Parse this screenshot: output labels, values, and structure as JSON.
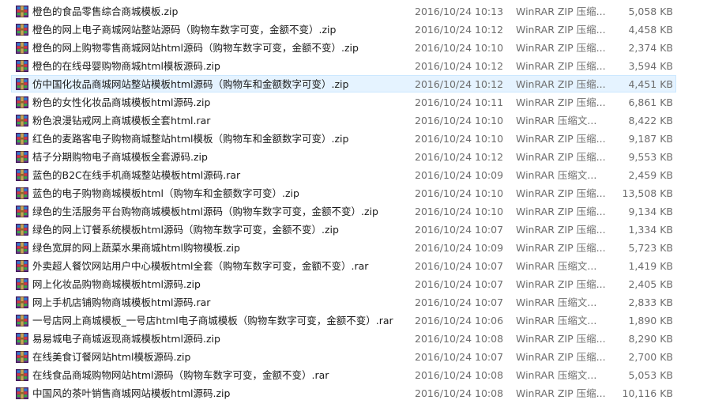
{
  "icon_name": "winrar-archive-icon",
  "colors": {
    "selected_row_bg": "#e5f3ff",
    "selected_row_border": "#cce8ff",
    "secondary_text": "#6d6d6d"
  },
  "files": [
    {
      "name": "橙色的食品零售综合商城模板.zip",
      "date": "2016/10/24 10:13",
      "type": "WinRAR ZIP 压缩...",
      "size": "5,058 KB"
    },
    {
      "name": "橙色的网上电子商城网站整站源码（购物车数字可变，金额不变）.zip",
      "date": "2016/10/24 10:12",
      "type": "WinRAR ZIP 压缩...",
      "size": "4,458 KB"
    },
    {
      "name": "橙色的网上购物零售商城网站html源码（购物车数字可变，金额不变）.zip",
      "date": "2016/10/24 10:10",
      "type": "WinRAR ZIP 压缩...",
      "size": "2,374 KB"
    },
    {
      "name": "橙色的在线母婴购物商城html模板源码.zip",
      "date": "2016/10/24 10:12",
      "type": "WinRAR ZIP 压缩...",
      "size": "3,594 KB"
    },
    {
      "name": "仿中国化妆品商城网站整站模板html源码（购物车和金额数字可变）.zip",
      "date": "2016/10/24 10:12",
      "type": "WinRAR ZIP 压缩...",
      "size": "4,451 KB",
      "selected": true
    },
    {
      "name": "粉色的女性化妆品商城模板html源码.zip",
      "date": "2016/10/24 10:11",
      "type": "WinRAR ZIP 压缩...",
      "size": "6,861 KB"
    },
    {
      "name": "粉色浪漫钻戒网上商城模板全套html.rar",
      "date": "2016/10/24 10:10",
      "type": "WinRAR 压缩文...",
      "size": "8,422 KB"
    },
    {
      "name": "红色的麦路客电子购物商城整站html模板（购物车和金额数字可变）.zip",
      "date": "2016/10/24 10:10",
      "type": "WinRAR ZIP 压缩...",
      "size": "9,187 KB"
    },
    {
      "name": "桔子分期购物电子商城模板全套源码.zip",
      "date": "2016/10/24 10:12",
      "type": "WinRAR ZIP 压缩...",
      "size": "9,553 KB"
    },
    {
      "name": "蓝色的B2C在线手机商城整站模板html源码.rar",
      "date": "2016/10/24 10:09",
      "type": "WinRAR 压缩文...",
      "size": "2,459 KB"
    },
    {
      "name": "蓝色的电子购物商城模板html（购物车和金额数字可变）.zip",
      "date": "2016/10/24 10:10",
      "type": "WinRAR ZIP 压缩...",
      "size": "13,508 KB"
    },
    {
      "name": "绿色的生活服务平台购物商城模板html源码（购物车数字可变，金额不变）.zip",
      "date": "2016/10/24 10:10",
      "type": "WinRAR ZIP 压缩...",
      "size": "9,134 KB"
    },
    {
      "name": "绿色的网上订餐系统模板html源码（购物车数字可变，金额不变）.zip",
      "date": "2016/10/24 10:07",
      "type": "WinRAR ZIP 压缩...",
      "size": "1,334 KB"
    },
    {
      "name": "绿色宽屏的网上蔬菜水果商城html购物模板.zip",
      "date": "2016/10/24 10:09",
      "type": "WinRAR ZIP 压缩...",
      "size": "5,723 KB"
    },
    {
      "name": "外卖超人餐饮网站用户中心模板html全套（购物车数字可变，金额不变）.rar",
      "date": "2016/10/24 10:07",
      "type": "WinRAR 压缩文...",
      "size": "1,419 KB"
    },
    {
      "name": "网上化妆品购物商城模板html源码.zip",
      "date": "2016/10/24 10:07",
      "type": "WinRAR ZIP 压缩...",
      "size": "2,405 KB"
    },
    {
      "name": "网上手机店铺购物商城模板html源码.rar",
      "date": "2016/10/24 10:07",
      "type": "WinRAR 压缩文...",
      "size": "2,833 KB"
    },
    {
      "name": "一号店网上商城模板_一号店html电子商城模板（购物车数字可变，金额不变）.rar",
      "date": "2016/10/24 10:06",
      "type": "WinRAR 压缩文...",
      "size": "1,890 KB"
    },
    {
      "name": "易易城电子商城返现商城模板html源码.zip",
      "date": "2016/10/24 10:08",
      "type": "WinRAR ZIP 压缩...",
      "size": "8,290 KB"
    },
    {
      "name": "在线美食订餐网站html模板源码.zip",
      "date": "2016/10/24 10:07",
      "type": "WinRAR ZIP 压缩...",
      "size": "2,700 KB"
    },
    {
      "name": "在线食品商城购物网站html源码（购物车数字可变，金额不变）.rar",
      "date": "2016/10/24 10:08",
      "type": "WinRAR 压缩文...",
      "size": "5,053 KB"
    },
    {
      "name": "中国风的茶叶销售商城网站模板html源码.zip",
      "date": "2016/10/24 10:08",
      "type": "WinRAR ZIP 压缩...",
      "size": "10,116 KB"
    }
  ]
}
